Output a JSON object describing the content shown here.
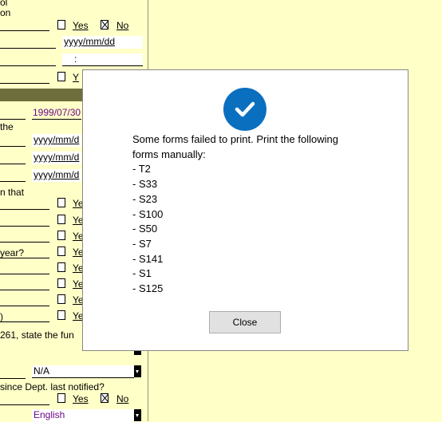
{
  "form": {
    "frag_top1": "ol",
    "frag_top2": "on",
    "yes_label": "Yes",
    "no_label": "No",
    "date_placeholder": "yyyy/mm/dd",
    "time_placeholder": ":",
    "y_frag": "Y",
    "frag_the": "the",
    "date_value": "1999/07/30",
    "date_frag": "yyyy/mm/d",
    "frag_on_that": "n that",
    "frag_ye": "Ye",
    "frag_year": "year?",
    "frag_paren": ")",
    "frag_261": "261, state the fun",
    "na_value": "N/A",
    "frag_since": "since Dept. last notified?",
    "language_value": "English"
  },
  "dialog": {
    "message_line1": "Some forms failed to print. Print the following",
    "message_line2": "forms manually:",
    "forms": [
      "- T2",
      "- S33",
      "- S23",
      "- S100",
      "- S50",
      "- S7",
      "- S141",
      "- S1",
      "- S125"
    ],
    "close_label": "Close",
    "icon": "checkmark-icon",
    "icon_color": "#0b6fc0"
  }
}
